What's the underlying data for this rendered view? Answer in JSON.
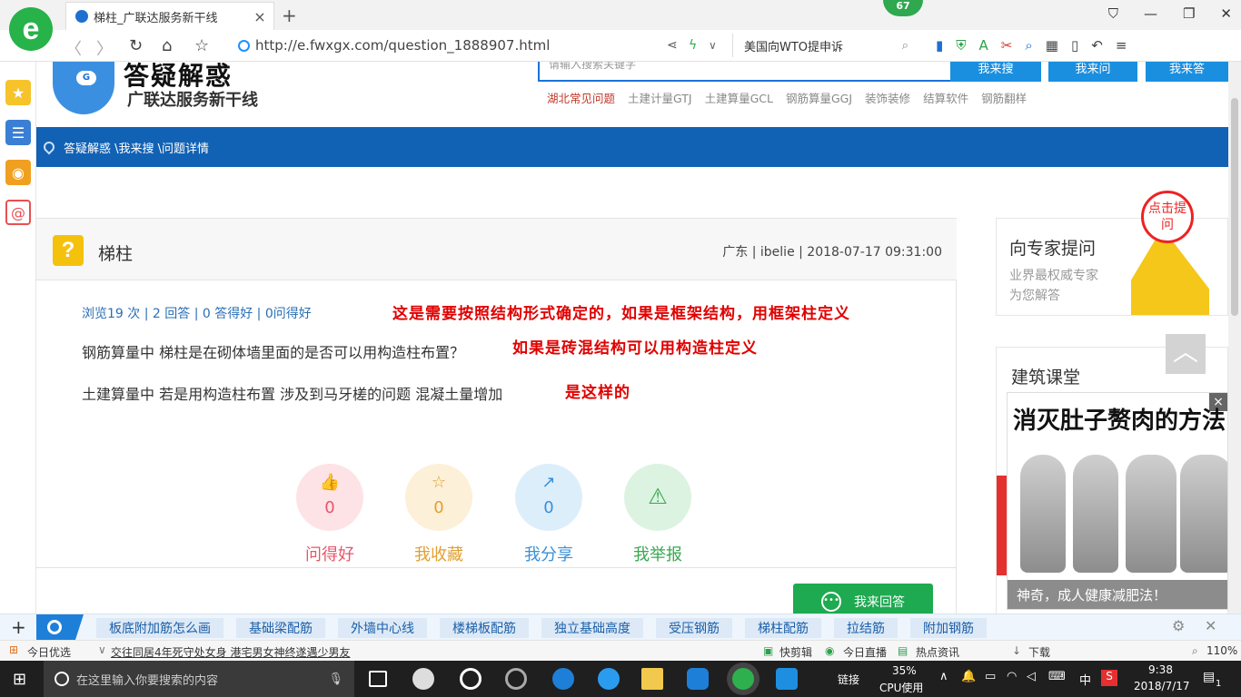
{
  "browser": {
    "tab_title": "梯柱_广联达服务新干线",
    "url": "http://e.fwxgx.com/question_1888907.html",
    "search_box": "美国向WTO提申诉",
    "badge": "67",
    "zoom": "110%"
  },
  "site": {
    "logo_main": "答疑解惑",
    "logo_sub": "广联达服务新干线",
    "search_placeholder": "请输入搜索关键字",
    "search_btn": "我来搜",
    "ask_btn": "我来问",
    "answer_top_btn": "我来答",
    "hotlinks": [
      "湖北常见问题",
      "土建计量GTJ",
      "土建算量GCL",
      "钢筋算量GGJ",
      "装饰装修",
      "结算软件",
      "钢筋翻样"
    ],
    "breadcrumb": "答疑解惑 \\我来搜 \\问题详情"
  },
  "question": {
    "title": "梯柱",
    "meta": "广东 | ibelie | 2018-07-17 09:31:00",
    "stats": "浏览19 次 | 2 回答 | 0 答得好 | 0问得好",
    "line1": "钢筋算量中 梯柱是在砌体墙里面的是否可以用构造柱布置？",
    "line2": "土建算量中 若是用构造柱布置 涉及到马牙槎的问题 混凝土量增加",
    "annotations": [
      "这是需要按照结构形式确定的，如果是框架结构，用框架柱定义",
      "如果是砖混结构可以用构造柱定义",
      "是这样的"
    ],
    "actions": [
      {
        "label": "问得好",
        "count": "0",
        "color": "#e8556a",
        "bg": "#fde3e6"
      },
      {
        "label": "我收藏",
        "count": "0",
        "color": "#e0a030",
        "bg": "#fdf0d9"
      },
      {
        "label": "我分享",
        "count": "0",
        "color": "#3a8fd8",
        "bg": "#ddeefb"
      },
      {
        "label": "我举报",
        "count": "",
        "color": "#38a850",
        "bg": "#dcf3e1"
      }
    ],
    "answer_btn": "我来回答"
  },
  "right": {
    "expert_title": "向专家提问",
    "expert_sub1": "业界最权威专家",
    "expert_sub2": "为您解答",
    "bubble": "点击提问",
    "course_title": "建筑课堂",
    "ad_title": "消灭肚子赘肉的方法",
    "ad_caption": "神奇，成人健康减肥法！"
  },
  "hotbar": [
    "板底附加筋怎么画",
    "基础梁配筋",
    "外墙中心线",
    "楼梯板配筋",
    "独立基础高度",
    "受压钢筋",
    "梯柱配筋",
    "拉结筋",
    "附加钢筋"
  ],
  "statusbar": {
    "left": "今日优选",
    "news": "交往同居4年死守处女身 港宅男女神终遂遇少男友",
    "items": [
      "快剪辑",
      "今日直播",
      "热点资讯",
      "下载"
    ]
  },
  "taskbar": {
    "search": "在这里输入你要搜索的内容",
    "link": "链接",
    "cpu_pct": "35%",
    "cpu_label": "CPU使用",
    "ime": "中",
    "time": "9:38",
    "date": "2018/7/17",
    "notif": "1"
  }
}
